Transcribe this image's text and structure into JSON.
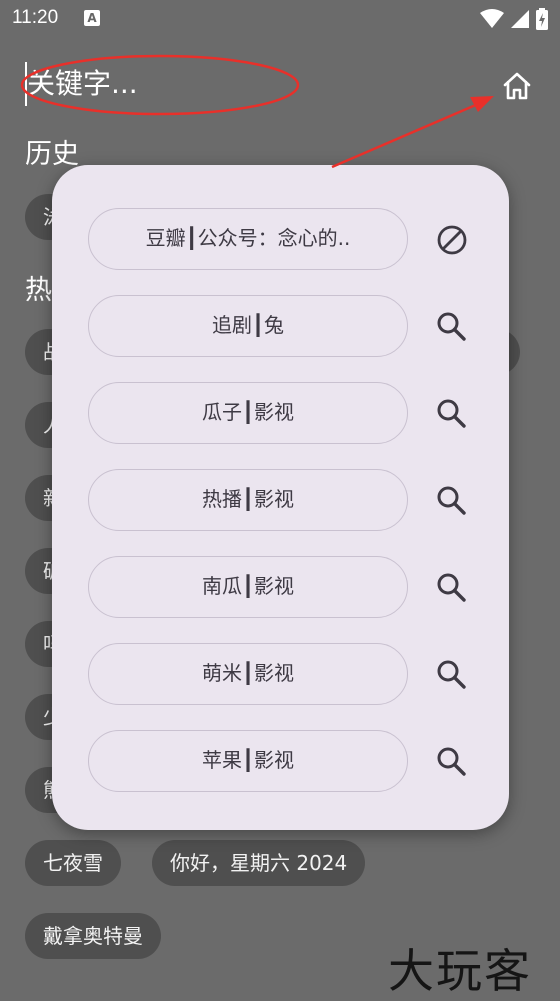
{
  "status_bar": {
    "time": "11:20",
    "a_badge": "A"
  },
  "search": {
    "placeholder": "关键字..."
  },
  "sections": {
    "history": "历史",
    "hot_partial": "热"
  },
  "background_chips": [
    {
      "label": "泳"
    },
    {
      "label": "战"
    },
    {
      "label": "人"
    },
    {
      "label": "新"
    },
    {
      "label": "破"
    },
    {
      "label": "吗"
    },
    {
      "label": "少"
    },
    {
      "label": "熊"
    },
    {
      "label": "七夜雪"
    },
    {
      "label": "你好，星期六 2024"
    },
    {
      "label": "戴拿奥特曼"
    }
  ],
  "popup": {
    "items": [
      {
        "label": "豆瓣┃公众号：念心的..",
        "action_icon": "block-icon"
      },
      {
        "label": "追剧┃兔",
        "action_icon": "search-icon"
      },
      {
        "label": "瓜子┃影视",
        "action_icon": "search-icon"
      },
      {
        "label": "热播┃影视",
        "action_icon": "search-icon"
      },
      {
        "label": "南瓜┃影视",
        "action_icon": "search-icon"
      },
      {
        "label": "萌米┃影视",
        "action_icon": "search-icon"
      },
      {
        "label": "苹果┃影视",
        "action_icon": "search-icon"
      }
    ]
  },
  "watermark": "大玩客",
  "colors": {
    "overlay_bg": "#6b6b6b",
    "popup_bg": "#ebe5ef",
    "annotation_red": "#e8302a",
    "chip_bg": "#4f4f4f"
  }
}
